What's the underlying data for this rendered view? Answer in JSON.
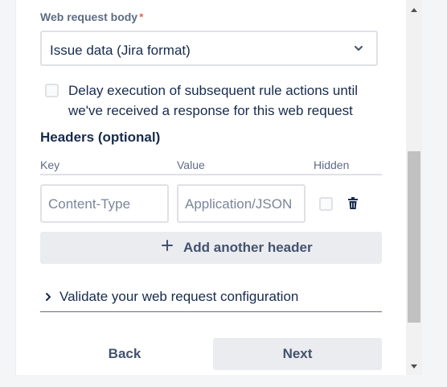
{
  "web_request_body": {
    "label": "Web request body",
    "required_marker": "*",
    "selected_value": "Issue data (Jira format)"
  },
  "delay_option": {
    "label": "Delay execution of subsequent rule actions until we've received a response for this web request",
    "checked": false
  },
  "headers": {
    "title": "Headers (optional)",
    "columns": [
      "Key",
      "Value",
      "Hidden"
    ],
    "rows": [
      {
        "key_placeholder": "Content-Type",
        "value_placeholder": "Application/JSON",
        "hidden": false
      }
    ],
    "add_label": "Add another header"
  },
  "validate": {
    "label": "Validate your web request configuration"
  },
  "footer": {
    "back_label": "Back",
    "next_label": "Next"
  },
  "icons": {
    "dropdown": "chevron-down-icon",
    "delete": "trash-icon",
    "add": "plus-icon",
    "expand": "chevron-right-icon"
  },
  "colors": {
    "text": "#172b4d",
    "muted": "#5e6c84",
    "button_bg": "#ebecf0",
    "required": "#de350b"
  }
}
